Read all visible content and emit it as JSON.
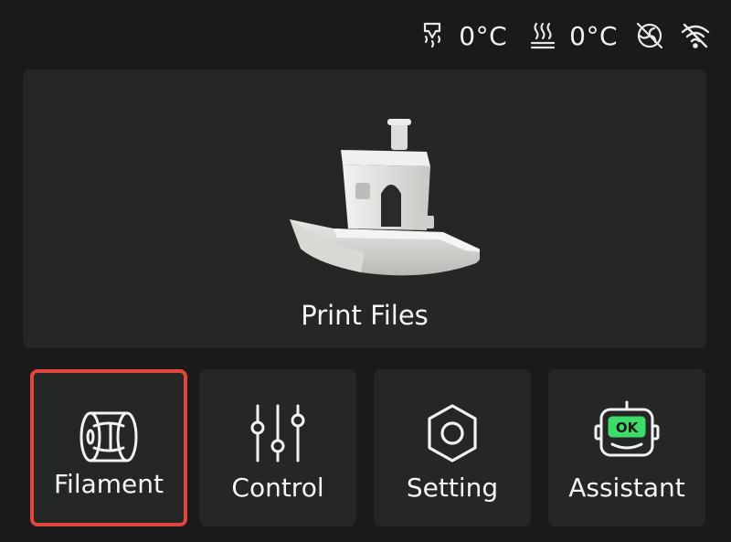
{
  "status": {
    "nozzle_icon": "nozzle-heat-icon",
    "nozzle_temp": "0°C",
    "bed_icon": "heated-bed-icon",
    "bed_temp": "0°C",
    "fan_icon": "fan-off-icon",
    "wifi_icon": "wifi-off-icon"
  },
  "main": {
    "print_files_label": "Print Files",
    "print_files_image": "benchy-boat-image"
  },
  "buttons": [
    {
      "label": "Filament",
      "icon": "filament-spool-icon",
      "selected": true
    },
    {
      "label": "Control",
      "icon": "sliders-icon",
      "selected": false
    },
    {
      "label": "Setting",
      "icon": "hex-nut-settings-icon",
      "selected": false
    },
    {
      "label": "Assistant",
      "icon": "assistant-robot-icon",
      "selected": false
    }
  ],
  "colors": {
    "background": "#1a1a1a",
    "card": "#252725",
    "selection": "#e0453e",
    "assistant_accent": "#3ddc6a"
  }
}
